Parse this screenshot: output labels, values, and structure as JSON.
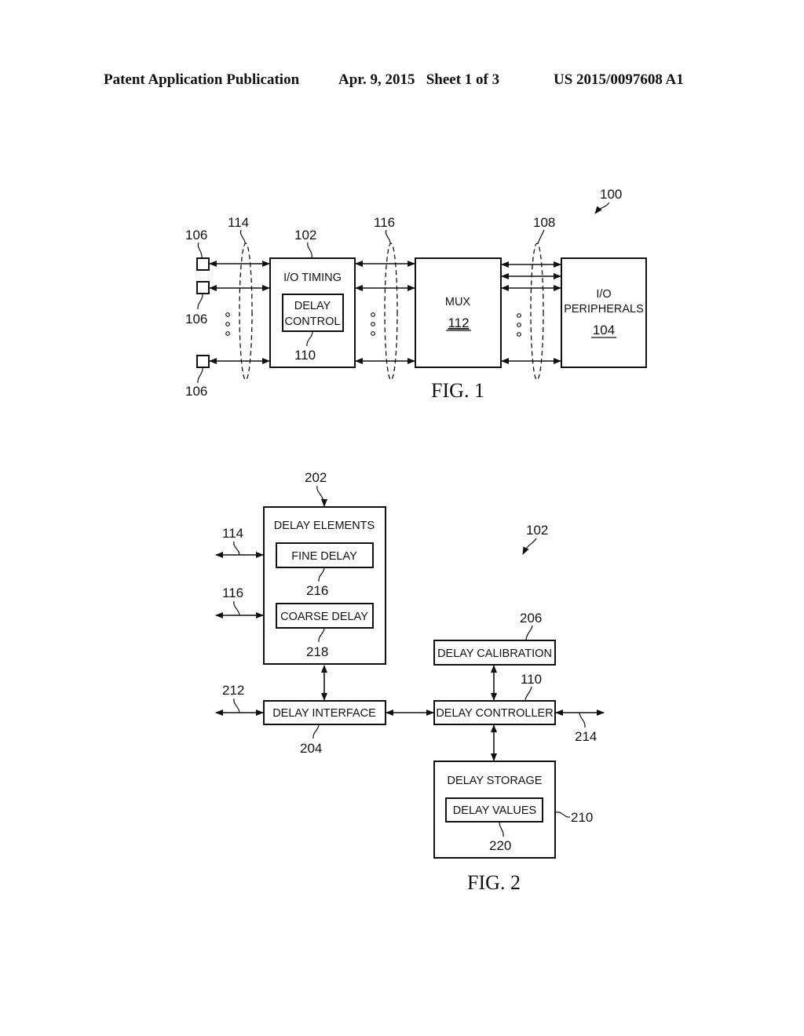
{
  "header": {
    "publication": "Patent Application Publication",
    "date_sheet": "Apr. 9, 2015   Sheet 1 of 3",
    "number": "US 2015/0097608 A1"
  },
  "fig1": {
    "caption": "FIG. 1",
    "system_ref": "100",
    "io_timing": {
      "label": "I/O TIMING",
      "ref": "102"
    },
    "delay_control": {
      "line1": "DELAY",
      "line2": "CONTROL",
      "ref": "110"
    },
    "mux": {
      "label": "MUX",
      "ref": "112"
    },
    "io_peripherals": {
      "line1": "I/O",
      "line2": "PERIPHERALS",
      "ref": "104"
    },
    "pad_ref": "106",
    "bus_refs": {
      "pads": "114",
      "mux": "116",
      "peripherals": "108"
    }
  },
  "fig2": {
    "caption": "FIG. 2",
    "system_ref": "102",
    "delay_elements": {
      "label": "DELAY ELEMENTS",
      "ref": "202"
    },
    "fine_delay": {
      "label": "FINE DELAY",
      "ref": "216"
    },
    "coarse_delay": {
      "label": "COARSE DELAY",
      "ref": "218"
    },
    "delay_interface": {
      "label": "DELAY INTERFACE",
      "ref": "204"
    },
    "delay_calibration": {
      "label": "DELAY CALIBRATION",
      "ref": "206"
    },
    "delay_controller": {
      "label": "DELAY CONTROLLER",
      "ref": "110"
    },
    "delay_storage": {
      "label": "DELAY STORAGE",
      "ref": "210"
    },
    "delay_values": {
      "label": "DELAY VALUES",
      "ref": "220"
    },
    "signal_refs": {
      "in_114": "114",
      "in_116": "116",
      "in_212": "212",
      "out_214": "214"
    }
  }
}
